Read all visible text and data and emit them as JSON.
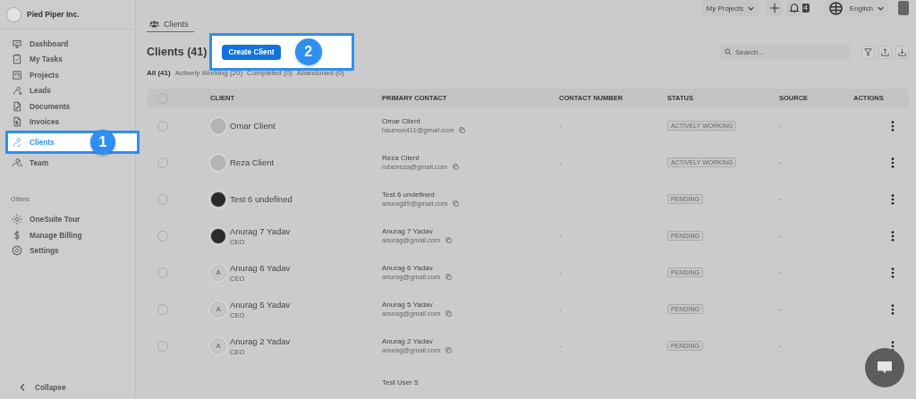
{
  "company": {
    "name": "Pied Piper Inc."
  },
  "topbar": {
    "projects_dropdown": "My Projects",
    "notification_count": "4",
    "language": "English"
  },
  "sidebar": {
    "items": [
      {
        "label": "Dashboard",
        "selected": false
      },
      {
        "label": "My Tasks",
        "selected": false
      },
      {
        "label": "Projects",
        "selected": false
      },
      {
        "label": "Leads",
        "selected": false
      },
      {
        "label": "Documents",
        "selected": false
      },
      {
        "label": "Invoices",
        "selected": false
      },
      {
        "label": "Clients",
        "selected": true,
        "callout": "1"
      },
      {
        "label": "Team",
        "selected": false
      }
    ],
    "section_title": "Others",
    "other_items": [
      {
        "label": "OneSuite Tour"
      },
      {
        "label": "Manage Billing"
      },
      {
        "label": "Settings"
      }
    ],
    "collapse": "Collapse"
  },
  "page_tab": "Clients",
  "title": "Clients (41)",
  "create_button": {
    "label": "Create Client",
    "callout": "2"
  },
  "search": {
    "placeholder": "Search..."
  },
  "filters": [
    {
      "label": "All (41)",
      "selected": true
    },
    {
      "label": "Actively Working (20)",
      "selected": false
    },
    {
      "label": "Completed (0)",
      "selected": false
    },
    {
      "label": "Abandoned (0)",
      "selected": false
    }
  ],
  "table": {
    "select_all_checked": false,
    "columns": [
      "CLIENT",
      "PRIMARY CONTACT",
      "CONTACT NUMBER",
      "STATUS",
      "SOURCE",
      "ACTIONS"
    ],
    "rows": [
      {
        "selected": false,
        "kind": "blank",
        "name": "Omar Client",
        "contact_name": "Omar Client",
        "email": "hsumon411@gmail.com",
        "phone": "-",
        "status": "ACTIVELY WORKING",
        "source": "-"
      },
      {
        "selected": false,
        "kind": "blank",
        "name": "Reza Client",
        "contact_name": "Reza Client",
        "email": "rubelreza@gmail.com",
        "phone": "-",
        "status": "ACTIVELY WORKING",
        "source": "-"
      },
      {
        "selected": false,
        "kind": "photo",
        "name": "Test 6 undefined",
        "contact_name": "Test 6 undefined",
        "email": "anurag89@gmail.com",
        "phone": "-",
        "status": "PENDING",
        "source": "-"
      },
      {
        "selected": false,
        "kind": "photo",
        "name": "Anurag 7 Yadav",
        "role": "CEO",
        "contact_name": "Anurag 7 Yadav",
        "email": "anurag@gmail.com",
        "phone": "-",
        "status": "PENDING",
        "source": "-"
      },
      {
        "selected": false,
        "kind": "letter",
        "initial": "A",
        "name": "Anurag 6 Yadav",
        "role": "CEO",
        "contact_name": "Anurag 6 Yadav",
        "email": "anurag@gmail.com",
        "phone": "-",
        "status": "PENDING",
        "source": "-"
      },
      {
        "selected": false,
        "kind": "letter",
        "initial": "A",
        "name": "Anurag 5 Yadav",
        "role": "CEO",
        "contact_name": "Anurag 5 Yadav",
        "email": "anurag@gmail.com",
        "phone": "-",
        "status": "PENDING",
        "source": "-"
      },
      {
        "selected": false,
        "kind": "letter",
        "initial": "A",
        "name": "Anurag 2 Yadav",
        "role": "CEO",
        "contact_name": "Anurag 2 Yadav",
        "email": "anurag@gmail.com",
        "phone": "-",
        "status": "PENDING",
        "source": "-"
      },
      {
        "contact_name": "Test User 5"
      }
    ]
  }
}
